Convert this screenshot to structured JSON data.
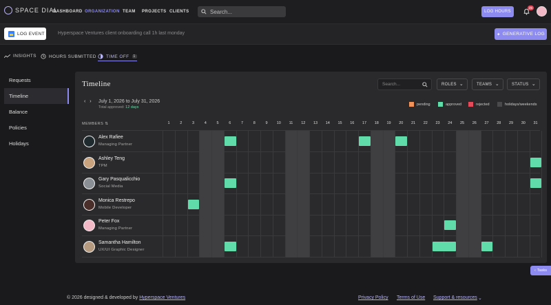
{
  "app": {
    "logo_text": "SPACE DIAL"
  },
  "nav": {
    "items": [
      "DASHBOARD",
      "ORGANIZATION",
      "TEAM",
      "PROJECTS",
      "CLIENTS"
    ],
    "active": "ORGANIZATION"
  },
  "search": {
    "placeholder": "Search..."
  },
  "header": {
    "log_hours": "LOG HOURS",
    "notif_count": "25"
  },
  "subbar": {
    "log_event": "LOG EVENT",
    "last_log": "Hyperspace Ventures client onboarding call 1h last monday",
    "generative_log": "GENERATIVE LOG"
  },
  "tabs": [
    {
      "label": "INSIGHTS",
      "icon": "trend-icon"
    },
    {
      "label": "HOURS SUBMITTED",
      "icon": "clock-icon"
    },
    {
      "label": "TIME OFF",
      "icon": "timeoff-icon",
      "badge": "1"
    }
  ],
  "sidebar": {
    "items": [
      "Requests",
      "Timeline",
      "Balance",
      "Policies",
      "Holidays"
    ],
    "active": "Timeline"
  },
  "panel": {
    "title": "Timeline",
    "search_placeholder": "Search...",
    "filters": [
      "ROLES",
      "TEAMS",
      "STATUS"
    ],
    "range": "July 1, 2026 to July 31, 2026",
    "total_label": "Total approved:",
    "total_value": "12 days",
    "legend": [
      {
        "label": "pending",
        "color": "#f0925a"
      },
      {
        "label": "approved",
        "color": "#5fdcaa"
      },
      {
        "label": "rejected",
        "color": "#e34b5a"
      },
      {
        "label": "holidays/weekends",
        "color": "#4a4a4d"
      }
    ],
    "members_label": "MEMBERS",
    "days": [
      "1",
      "2",
      "3",
      "4",
      "5",
      "6",
      "7",
      "8",
      "9",
      "10",
      "11",
      "12",
      "13",
      "14",
      "15",
      "16",
      "17",
      "18",
      "19",
      "20",
      "21",
      "22",
      "23",
      "24",
      "25",
      "26",
      "27",
      "28",
      "29",
      "30",
      "31"
    ],
    "weekend_days": [
      4,
      5,
      11,
      12,
      18,
      19,
      25,
      26
    ],
    "members": [
      {
        "name": "Alex Rafiee",
        "role": "Managing Partner",
        "avatar_color": "#1f2a2e",
        "approved_ranges": [
          [
            6,
            6
          ],
          [
            17,
            17
          ],
          [
            20,
            20
          ]
        ]
      },
      {
        "name": "Ashley Teng",
        "role": "TPM",
        "avatar_color": "#c9a27e",
        "approved_ranges": [
          [
            31,
            31
          ]
        ]
      },
      {
        "name": "Gary Pasqualicchio",
        "role": "Social Media",
        "avatar_color": "#8a8f96",
        "approved_ranges": [
          [
            6,
            6
          ],
          [
            31,
            31
          ]
        ]
      },
      {
        "name": "Monica Restrepo",
        "role": "Mobile Developer",
        "avatar_color": "#4a2e2a",
        "approved_ranges": [
          [
            3,
            3
          ]
        ]
      },
      {
        "name": "Peter Fox",
        "role": "Managing Partner",
        "avatar_color": "#f2b8c6",
        "approved_ranges": [
          [
            24,
            24
          ]
        ]
      },
      {
        "name": "Samantha Hamilton",
        "role": "UX/UI Graphic Designer",
        "avatar_color": "#b59a80",
        "approved_ranges": [
          [
            6,
            6
          ],
          [
            23,
            24
          ],
          [
            27,
            27
          ]
        ]
      }
    ]
  },
  "tasks_label": "Tasks",
  "footer": {
    "copyright": "© 2026 designed & developed by",
    "company": "Hyperspace Ventures",
    "links": [
      "Privacy Policy",
      "Terms of Use",
      "Support & resources"
    ]
  }
}
